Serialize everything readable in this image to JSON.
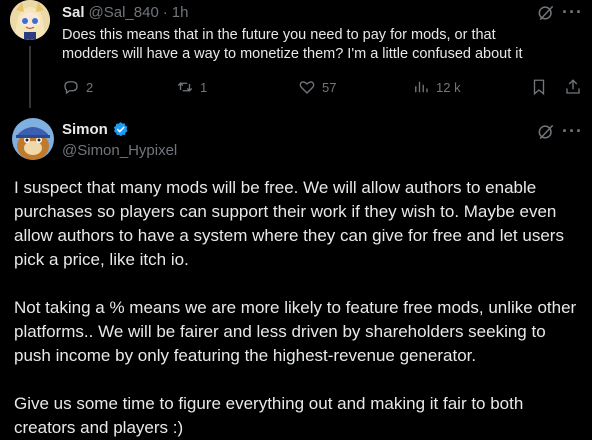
{
  "reply": {
    "author_name": "Sal",
    "handle": "@Sal_840",
    "separator": "·",
    "time": "1h",
    "text_line1": "Does this means that in the future you need to pay for mods, or that",
    "text_line2": "modders will have a way to monetize them? I'm a little confused about it",
    "counts": {
      "replies": "2",
      "reposts": "1",
      "likes": "57",
      "views": "12 k"
    }
  },
  "main": {
    "author_name": "Simon",
    "handle": "@Simon_Hypixel",
    "paragraphs": [
      "I suspect that many mods will be free. We will allow authors to enable purchases so players can support their work if they wish to. Maybe even allow authors to have a system where they can give for free and let users pick a price, like itch io.",
      "Not taking a % means we are more likely to feature free mods, unlike other platforms.. We will be fairer and less driven by shareholders seeking to push income by only featuring the highest-revenue generator.",
      "Give us some time to figure everything out and making it fair to both creators and players :)"
    ]
  },
  "icons": {
    "grok": "grok-icon",
    "more": "more-icon",
    "reply": "reply-icon",
    "repost": "repost-icon",
    "like": "heart-icon",
    "views": "views-icon",
    "bookmark": "bookmark-icon",
    "share": "share-icon",
    "verified": "verified-icon"
  },
  "colors": {
    "background": "#000000",
    "text": "#e7e9ea",
    "muted": "#71767b",
    "verified": "#1d9bf0"
  }
}
